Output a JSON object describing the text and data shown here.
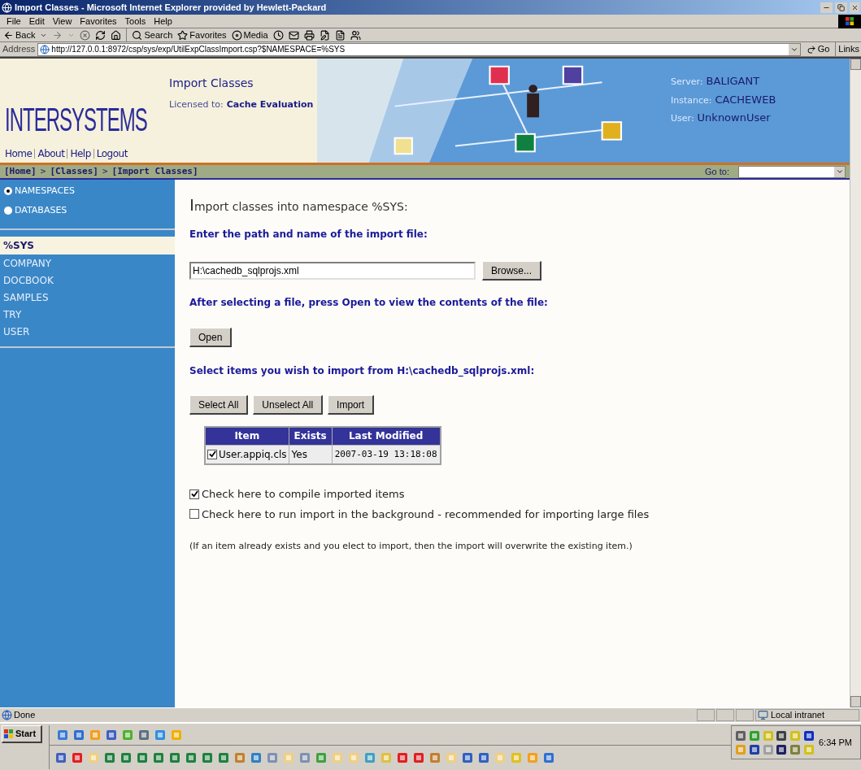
{
  "window": {
    "title": "Import Classes - Microsoft Internet Explorer provided by Hewlett-Packard"
  },
  "menu": [
    "File",
    "Edit",
    "View",
    "Favorites",
    "Tools",
    "Help"
  ],
  "toolbar": {
    "back": "Back",
    "search": "Search",
    "favorites": "Favorites",
    "media": "Media"
  },
  "address": {
    "label": "Address",
    "value": "http://127.0.0.1:8972/csp/sys/exp/UtilExpClassImport.csp?$NAMESPACE=%SYS",
    "go": "Go",
    "links": "Links"
  },
  "header": {
    "logo": "INTERSYSTEMS",
    "links": [
      "Home",
      "About",
      "Help",
      "Logout"
    ],
    "title": "Import Classes",
    "licensed_label": "Licensed to:",
    "licensed_value": "Cache Evaluation",
    "info": [
      {
        "label": "Server:",
        "value": "BALIGANT"
      },
      {
        "label": "Instance:",
        "value": "CACHEWEB"
      },
      {
        "label": "User:",
        "value": "UnknownUser"
      }
    ]
  },
  "breadcrumb": {
    "items": [
      "[Home]",
      "[Classes]",
      "[Import Classes]"
    ],
    "separators": [
      ">",
      ">"
    ],
    "goto_label": "Go to:"
  },
  "sidebar": {
    "modes": [
      {
        "label": "NAMESPACES",
        "selected": true
      },
      {
        "label": "DATABASES",
        "selected": false
      }
    ],
    "items": [
      {
        "label": "%SYS",
        "selected": true
      },
      {
        "label": "COMPANY",
        "selected": false
      },
      {
        "label": "DOCBOOK",
        "selected": false
      },
      {
        "label": "SAMPLES",
        "selected": false
      },
      {
        "label": "TRY",
        "selected": false
      },
      {
        "label": "USER",
        "selected": false
      }
    ]
  },
  "main": {
    "heading": "Import classes into namespace %SYS:",
    "path_prompt": "Enter the path and name of the import file:",
    "path_value": "H:\\cachedb_sqlprojs.xml",
    "browse": "Browse...",
    "open_prompt": "After selecting a file, press Open to view the contents of the file:",
    "open": "Open",
    "select_prompt": "Select items you wish to import from H:\\cachedb_sqlprojs.xml:",
    "buttons": [
      "Select All",
      "Unselect All",
      "Import"
    ],
    "table": {
      "columns": [
        "Item",
        "Exists",
        "Last Modified"
      ],
      "rows": [
        {
          "checked": true,
          "item": "User.appiq.cls",
          "exists": "Yes",
          "modified": "2007-03-19 13:18:08"
        }
      ]
    },
    "options": [
      {
        "label": "Check here to compile imported items",
        "checked": true
      },
      {
        "label": "Check here to run import in the background - recommended for importing large files",
        "checked": false
      }
    ],
    "note": "(If an item already exists and you elect to import, then the import will overwrite the existing item.)"
  },
  "status_bar": {
    "text": "Done",
    "zone": "Local intranet"
  },
  "taskbar": {
    "start": "Start",
    "clock": "6:34 PM"
  }
}
